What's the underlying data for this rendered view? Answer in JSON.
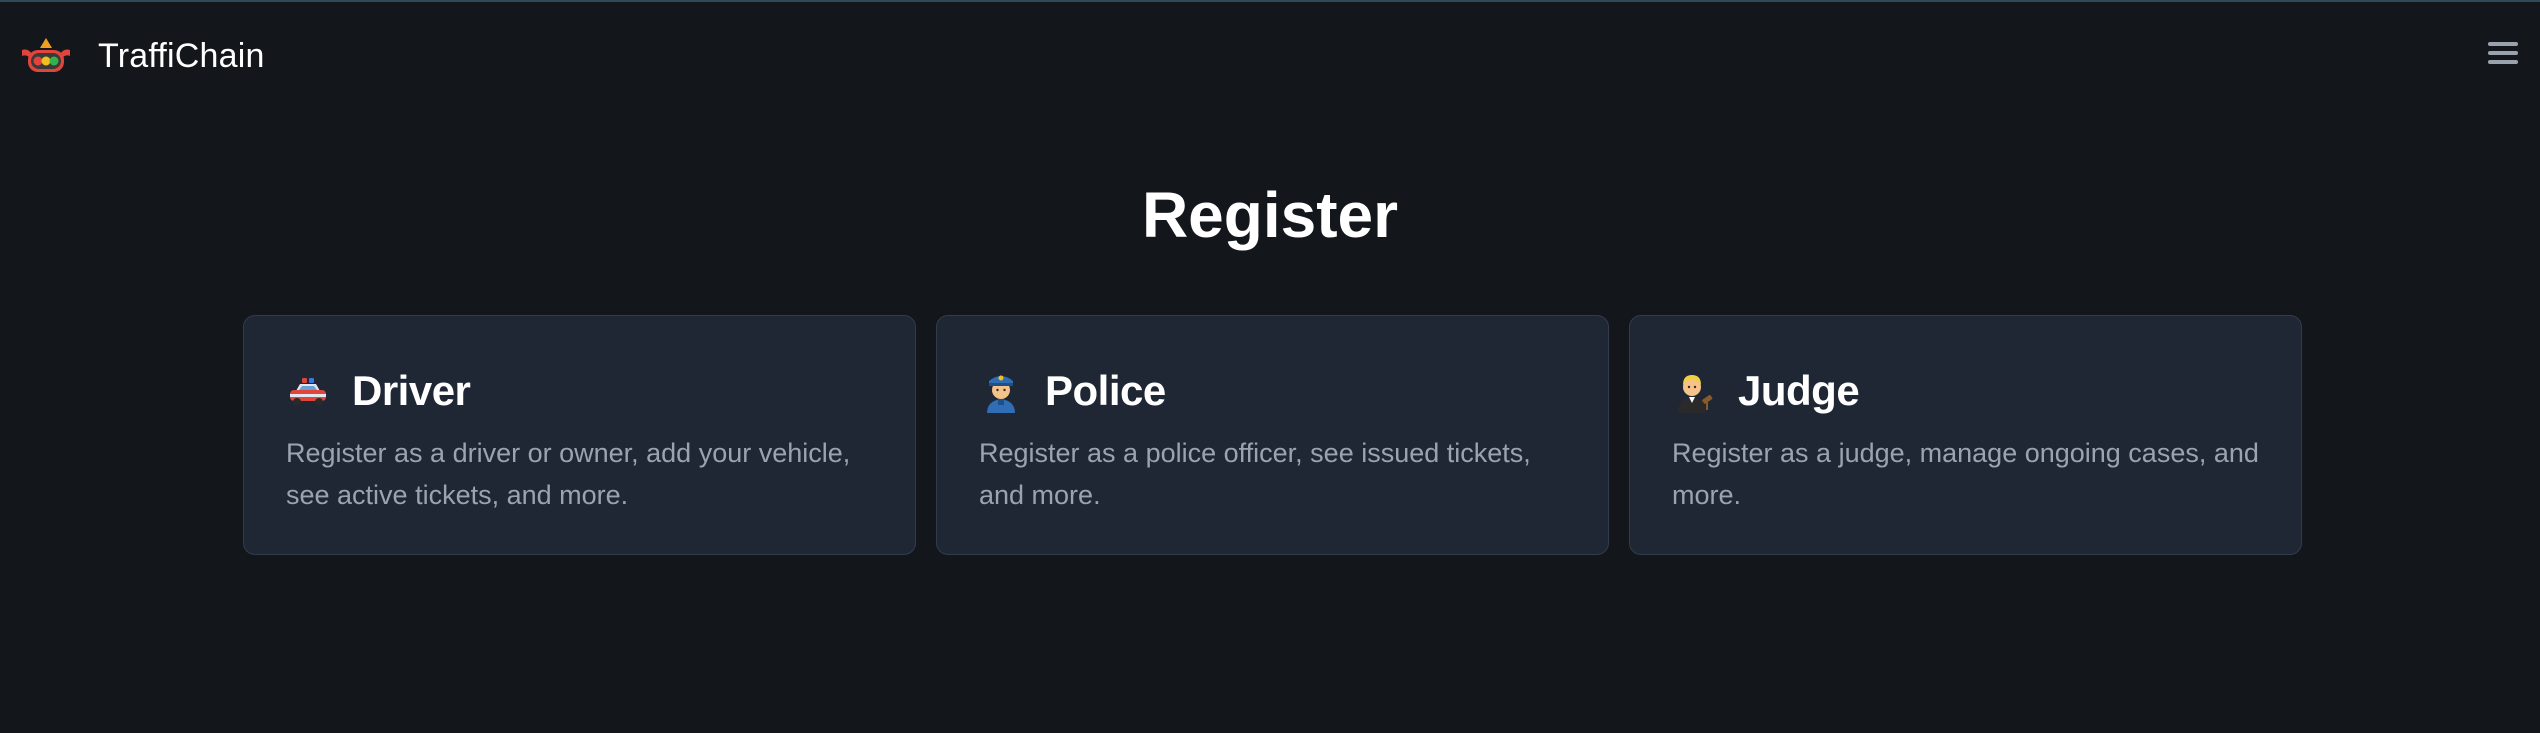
{
  "app": {
    "name": "TraffiChain",
    "logo_icon": "traffic-light-icon",
    "menu_icon": "hamburger-menu-icon"
  },
  "page": {
    "title": "Register"
  },
  "cards": [
    {
      "icon": "police-car-icon",
      "title": "Driver",
      "description": "Register as a driver or owner, add your vehicle, see active tickets, and more."
    },
    {
      "icon": "police-officer-icon",
      "title": "Police",
      "description": "Register as a police officer, see issued tickets, and more."
    },
    {
      "icon": "judge-icon",
      "title": "Judge",
      "description": "Register as a judge, manage ongoing cases, and more."
    }
  ],
  "colors": {
    "background": "#13171c",
    "card_background": "#1f2735",
    "card_border": "#323c4c",
    "text": "#ffffff",
    "muted_text": "#9ba3af"
  }
}
